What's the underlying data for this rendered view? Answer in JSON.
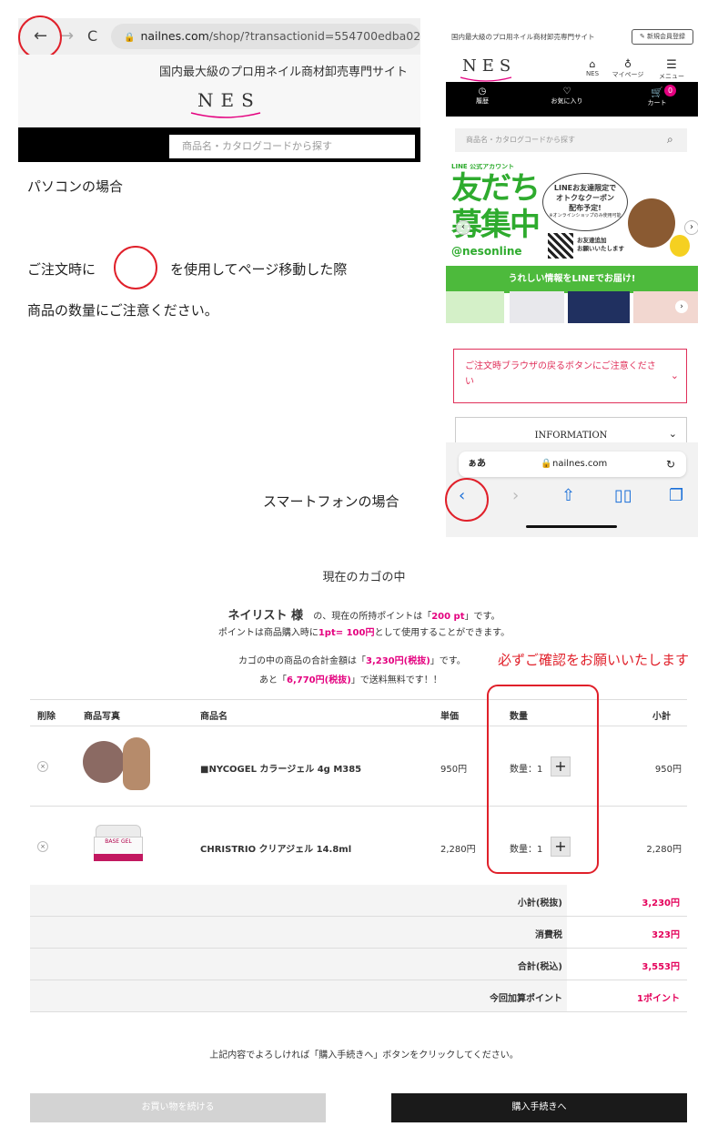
{
  "pc": {
    "url_prefix": "nailnes.com",
    "url_rest": "/shop/?transactionid=554700edba029b50b",
    "tagline": "国内最大級のプロ用ネイル商材卸売専門サイト",
    "logo": "NES",
    "search_placeholder": "商品名・カタログコードから探す",
    "caption": "パソコンの場合"
  },
  "instructions": {
    "line1_before": "ご注文時に",
    "line1_after": "を使用してページ移動した際",
    "line2": "商品の数量にご注意ください。"
  },
  "sp": {
    "tagline": "国内最大級のプロ用ネイル商材卸売専門サイト",
    "register": "新規会員登録",
    "logo": "NES",
    "nav": [
      "NES",
      "マイページ",
      "メニュー"
    ],
    "bar": [
      "履歴",
      "お気に入り",
      "カート"
    ],
    "cart_count": "0",
    "search_placeholder": "商品名・カタログコードから探す",
    "banner": {
      "line_account": "LINE 公式アカウント",
      "big1": "友だち",
      "big2": "募集中",
      "bubble1": "LINEお友達限定で",
      "bubble2": "オトクなクーポン",
      "bubble3": "配布予定!",
      "bubble4": "※オンラインショップのみ使用可能",
      "handle": "@nesonline",
      "qr_text1": "お友達追加",
      "qr_text2": "お願いいたします",
      "strip": "うれしい情報をLINEでお届け!"
    },
    "notice": "ご注文時ブラウザの戻るボタンにご注意ください",
    "info": "INFORMATION",
    "safari_aa": "ぁあ",
    "safari_url": "nailnes.com",
    "caption": "スマートフォンの場合"
  },
  "cart": {
    "title": "現在のカゴの中",
    "user_name": "ネイリスト 様",
    "points_before": "の、現在の所持ポイントは「",
    "points_value": "200 pt",
    "points_after": "」です。",
    "rate_before": "ポイントは商品購入時に",
    "rate_value": "1pt= 100円",
    "rate_after": "として使用することができます。",
    "total_before": "カゴの中の商品の合計金額は「",
    "total_value": "3,230円(税抜)",
    "total_after": "」です。",
    "free_before": "あと「",
    "free_value": "6,770円(税抜)",
    "free_after": "」で送料無料です！！",
    "confirm_note": "必ずご確認をお願いいたします",
    "headers": [
      "削除",
      "商品写真",
      "商品名",
      "単価",
      "数量",
      "小計"
    ],
    "items": [
      {
        "name": "■NYCOGEL カラージェル 4g M385",
        "price": "950円",
        "qty": "数量：1",
        "subtotal": "950円",
        "delete": "×",
        "plus": "+"
      },
      {
        "name": "CHRISTRIO クリアジェル 14.8ml",
        "price": "2,280円",
        "qty": "数量：1",
        "subtotal": "2,280円",
        "delete": "×",
        "plus": "+",
        "jar_label": "BASE GEL"
      }
    ],
    "summary": [
      {
        "label": "小計(税抜)",
        "value": "3,230円"
      },
      {
        "label": "消費税",
        "value": "323円"
      },
      {
        "label": "合計(税込)",
        "value": "3,553円"
      },
      {
        "label": "今回加算ポイント",
        "value": "1ポイント"
      }
    ],
    "guide": "上記内容でよろしければ「購入手続きへ」ボタンをクリックしてください。",
    "continue_btn": "お買い物を続ける",
    "checkout_btn": "購入手続きへ"
  },
  "colors": {
    "accent_pink": "#e4007f",
    "annotation_red": "#e0202a",
    "line_green": "#4dba3c"
  }
}
